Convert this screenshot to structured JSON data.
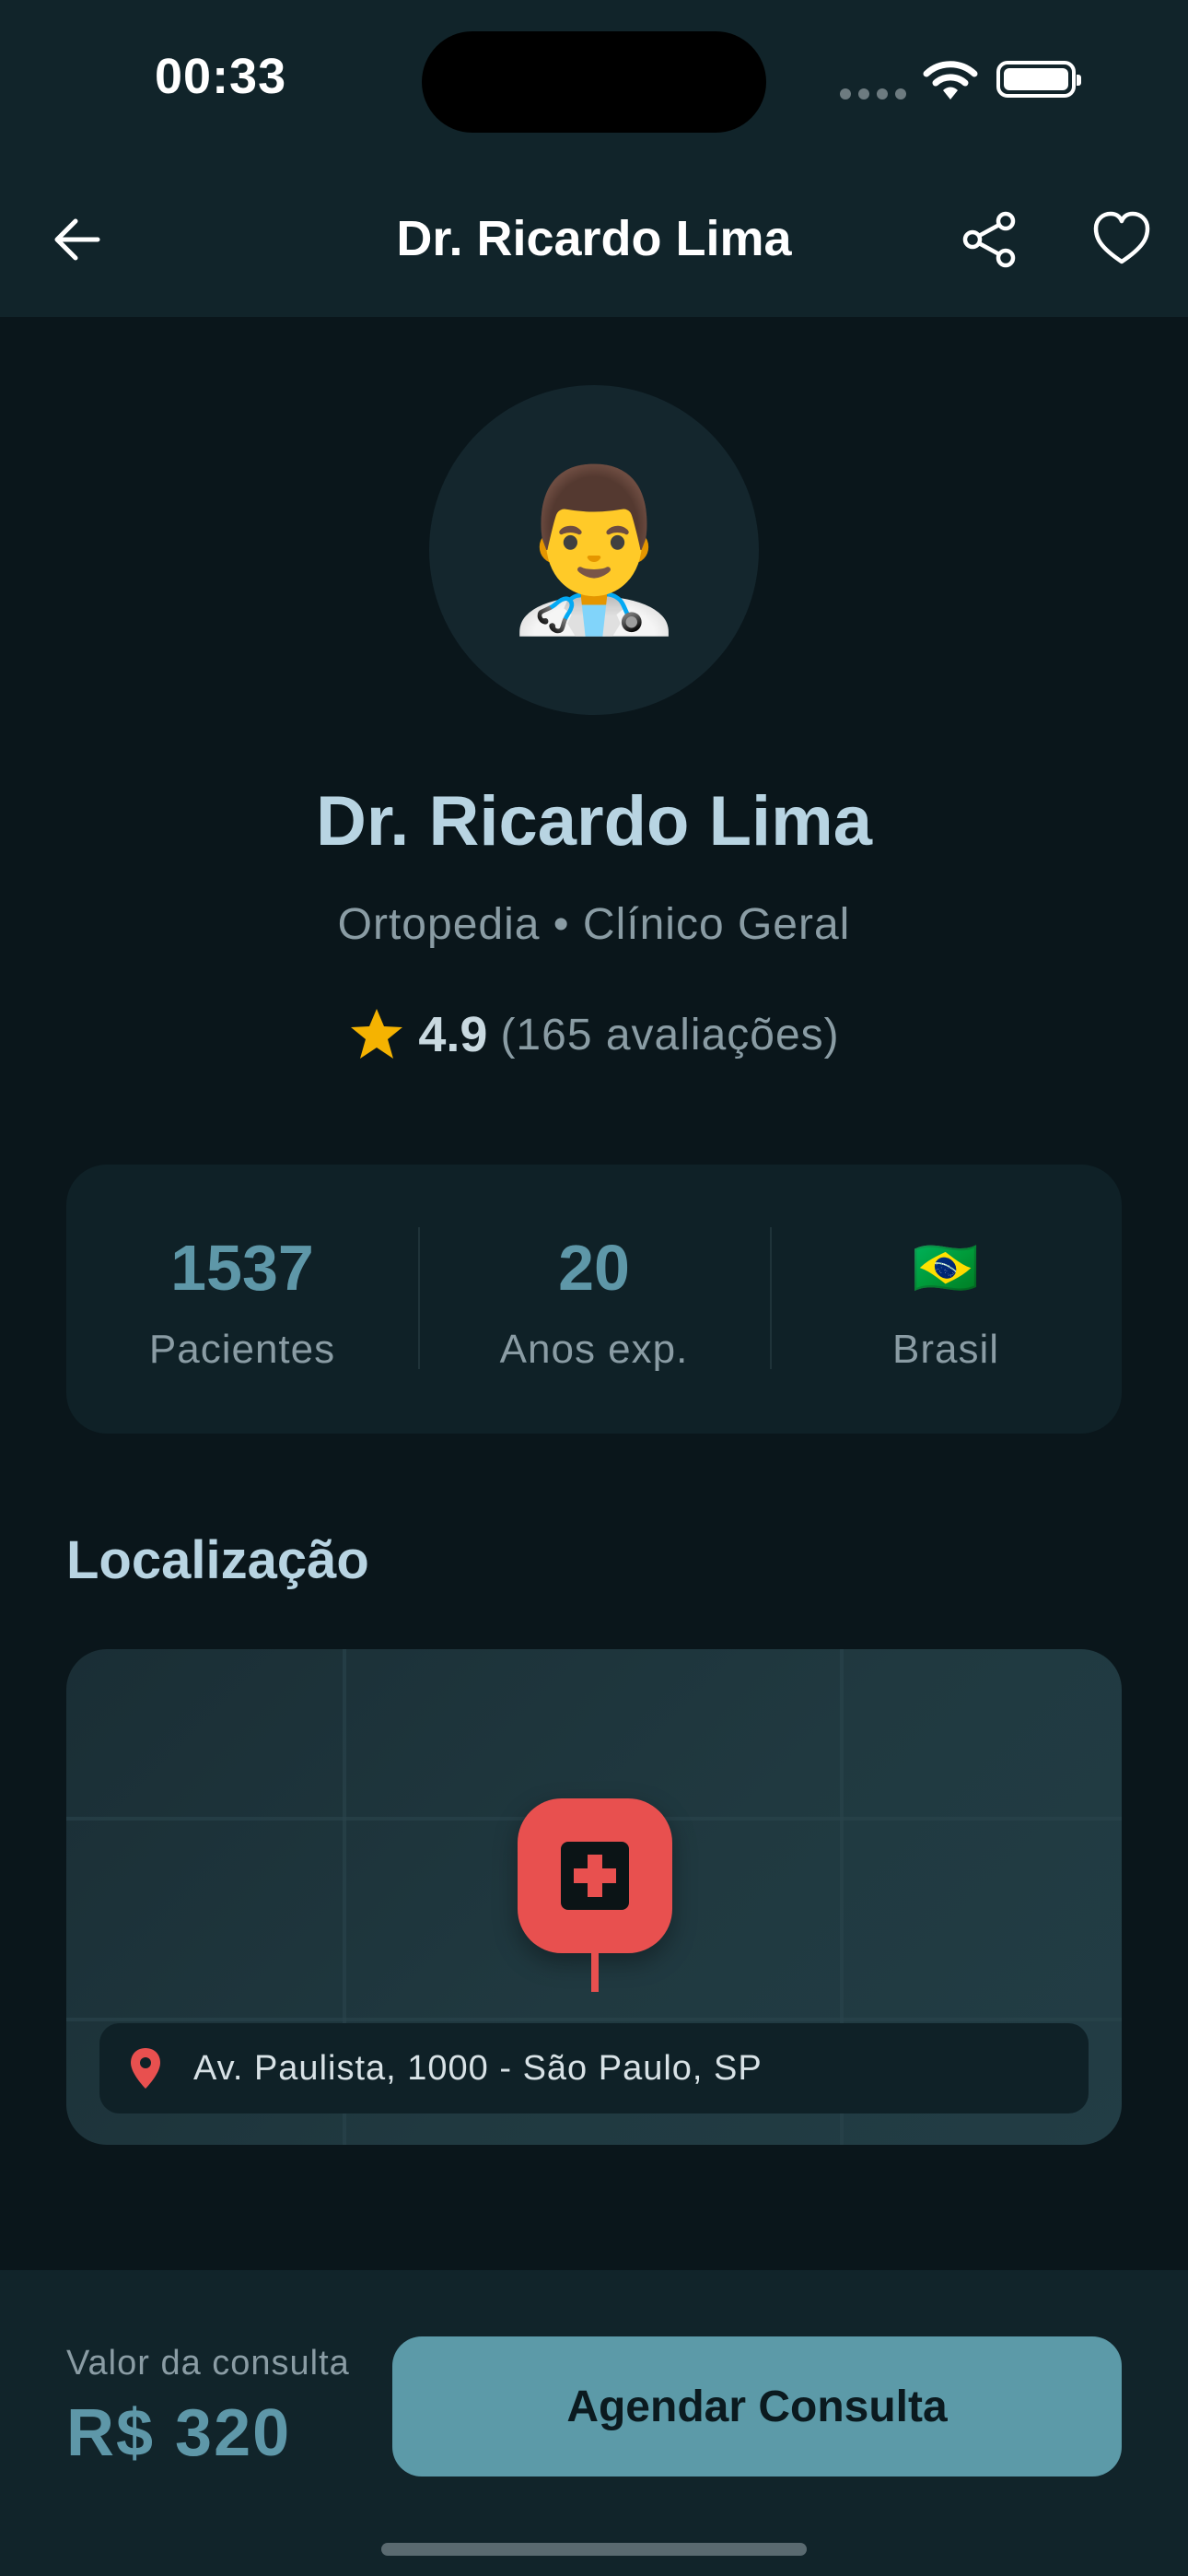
{
  "status_bar": {
    "time": "00:33"
  },
  "header": {
    "title": "Dr. Ricardo Lima"
  },
  "profile": {
    "avatar_emoji": "👨‍⚕️",
    "name": "Dr. Ricardo Lima",
    "specialties": "Ortopedia • Clínico Geral",
    "rating": "4.9",
    "rating_count": "(165 avaliações)"
  },
  "stats": [
    {
      "value": "1537",
      "label": "Pacientes"
    },
    {
      "value": "20",
      "label": "Anos exp."
    },
    {
      "flag": "🇧🇷",
      "label": "Brasil"
    }
  ],
  "location": {
    "title": "Localização",
    "address": "Av. Paulista, 1000 - São Paulo, SP"
  },
  "booking": {
    "price_label": "Valor da consulta",
    "price": "R$ 320",
    "button_label": "Agendar Consulta"
  },
  "colors": {
    "accent": "#5c9aa8",
    "pin": "#e8504f",
    "star": "#f5b301",
    "background": "#0a161b",
    "header": "#11242a"
  },
  "icons": {
    "back": "arrow-left-icon",
    "share": "share-icon",
    "favorite": "heart-icon",
    "star": "star-icon",
    "pin": "map-pin-icon",
    "clinic": "medical-cross-icon"
  }
}
